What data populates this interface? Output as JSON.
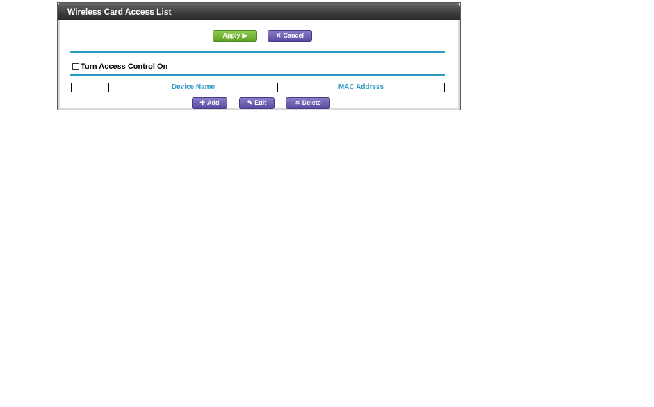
{
  "panel": {
    "title": "Wireless Card Access List"
  },
  "actions": {
    "apply_label": "Apply",
    "cancel_label": "Cancel"
  },
  "access_control": {
    "label": "Turn Access Control On",
    "checked": false
  },
  "table": {
    "columns": [
      "",
      "Device Name",
      "MAC Address"
    ],
    "rows": []
  },
  "list_actions": {
    "add_label": "Add",
    "edit_label": "Edit",
    "delete_label": "Delete"
  },
  "colors": {
    "accent": "#2a9bc2",
    "apply": "#6db33a",
    "button_purple": "#6b5cb3",
    "title_bar": "#3e3e3e"
  },
  "icons": {
    "apply": "play-arrow-icon",
    "cancel": "x-icon",
    "add": "plus-icon",
    "edit": "pencil-icon",
    "delete": "x-icon"
  }
}
